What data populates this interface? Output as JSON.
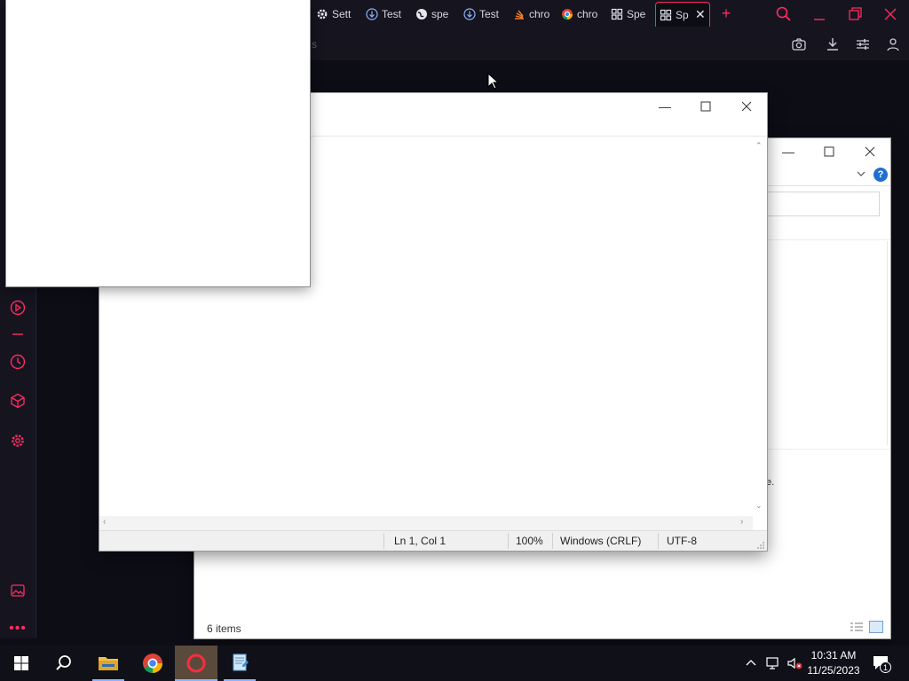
{
  "browser": {
    "tabs": [
      {
        "label": "Sett",
        "icon": "gear-icon"
      },
      {
        "label": "Test",
        "icon": "download-circle-icon"
      },
      {
        "label": "spe",
        "icon": "globe-icon"
      },
      {
        "label": "Test",
        "icon": "download-circle-icon"
      },
      {
        "label": "chro",
        "icon": "stack-icon"
      },
      {
        "label": "chro",
        "icon": "chrome-icon"
      },
      {
        "label": "Spe",
        "icon": "grid-icon"
      },
      {
        "label": "Sp",
        "icon": "grid-icon"
      }
    ],
    "address_hint": "s",
    "accent": "#ff2b63"
  },
  "explorer": {
    "status_items": "6 items",
    "truncated_text": "e."
  },
  "notepad": {
    "position": "Ln 1, Col 1",
    "zoom": "100%",
    "line_ending": "Windows (CRLF)",
    "encoding": "UTF-8"
  },
  "taskbar": {
    "time": "10:31 AM",
    "date": "11/25/2023",
    "notification_count": "1"
  }
}
